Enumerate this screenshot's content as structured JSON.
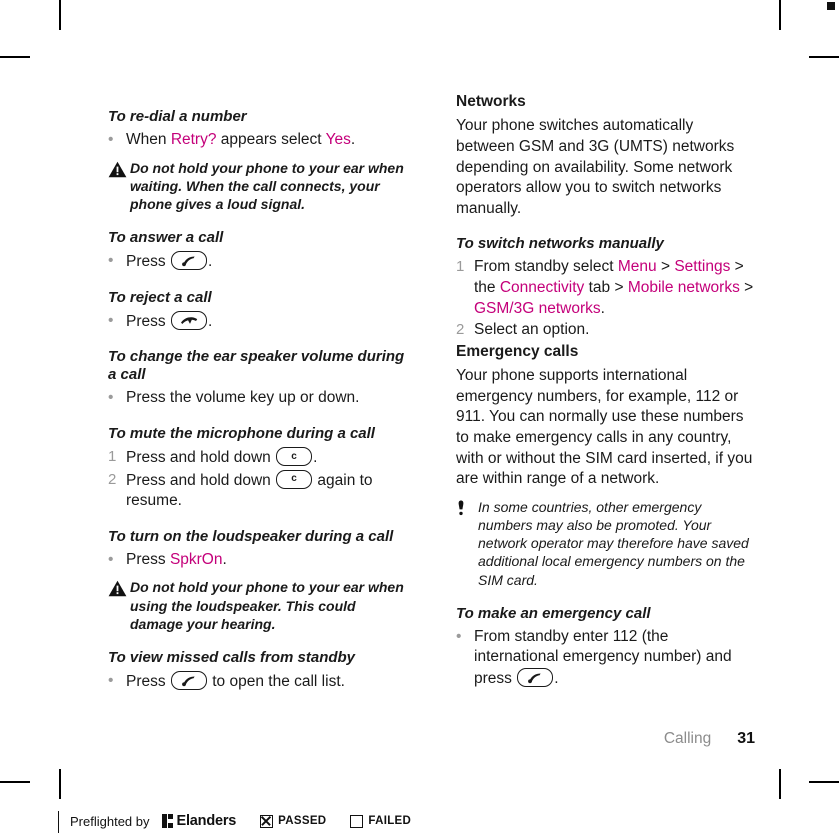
{
  "document": {
    "chapter": "Calling",
    "page_number": "31"
  },
  "accent_color": "#c4007a",
  "left_column": [
    {
      "type": "task-heading",
      "name": "heading-redial",
      "text": "To re-dial a number"
    },
    {
      "type": "bullet",
      "name": "step-redial",
      "parts": [
        {
          "t": "When ",
          "style": "plain"
        },
        {
          "t": "Retry?",
          "style": "ui"
        },
        {
          "t": " appears select ",
          "style": "plain"
        },
        {
          "t": "Yes",
          "style": "ui"
        },
        {
          "t": ".",
          "style": "plain"
        }
      ]
    },
    {
      "type": "note-warning",
      "name": "note-redial-warning",
      "icon": "warning-triangle-icon",
      "text": "Do not hold your phone to your ear when waiting. When the call connects, your phone gives a loud signal."
    },
    {
      "type": "task-heading",
      "name": "heading-answer-call",
      "text": "To answer a call"
    },
    {
      "type": "bullet",
      "name": "step-answer-call",
      "parts": [
        {
          "t": "Press ",
          "style": "plain"
        },
        {
          "t": "",
          "style": "key",
          "key": "call-key",
          "glyph": "handset-up"
        },
        {
          "t": ".",
          "style": "plain"
        }
      ]
    },
    {
      "type": "task-heading",
      "name": "heading-reject-call",
      "text": "To reject a call"
    },
    {
      "type": "bullet",
      "name": "step-reject-call",
      "parts": [
        {
          "t": "Press ",
          "style": "plain"
        },
        {
          "t": "",
          "style": "key",
          "key": "end-call-key",
          "glyph": "handset-down"
        },
        {
          "t": ".",
          "style": "plain"
        }
      ]
    },
    {
      "type": "task-heading",
      "name": "heading-ear-speaker-volume",
      "text": "To change the ear speaker volume during a call"
    },
    {
      "type": "bullet",
      "name": "step-ear-speaker-volume",
      "parts": [
        {
          "t": "Press the volume key up or down.",
          "style": "plain"
        }
      ]
    },
    {
      "type": "task-heading",
      "name": "heading-mute-microphone",
      "text": "To mute the microphone during a call"
    },
    {
      "type": "numbered",
      "name": "step-mute-1",
      "number": "1",
      "parts": [
        {
          "t": "Press and hold down ",
          "style": "plain"
        },
        {
          "t": "",
          "style": "key",
          "key": "clear-key",
          "glyph": "c"
        },
        {
          "t": ".",
          "style": "plain"
        }
      ]
    },
    {
      "type": "numbered",
      "name": "step-mute-2",
      "number": "2",
      "parts": [
        {
          "t": "Press and hold down ",
          "style": "plain"
        },
        {
          "t": "",
          "style": "key",
          "key": "clear-key",
          "glyph": "c"
        },
        {
          "t": " again to resume.",
          "style": "plain"
        }
      ]
    },
    {
      "type": "task-heading",
      "name": "heading-loudspeaker",
      "text": "To turn on the loudspeaker during a call"
    },
    {
      "type": "bullet",
      "name": "step-loudspeaker",
      "parts": [
        {
          "t": "Press ",
          "style": "plain"
        },
        {
          "t": "SpkrOn",
          "style": "ui"
        },
        {
          "t": ".",
          "style": "plain"
        }
      ]
    },
    {
      "type": "note-warning",
      "name": "note-loudspeaker-warning",
      "icon": "warning-triangle-icon",
      "text": "Do not hold your phone to your ear when using the loudspeaker. This could damage your hearing."
    },
    {
      "type": "task-heading",
      "name": "heading-missed-calls",
      "text": "To view missed calls from standby"
    },
    {
      "type": "bullet",
      "name": "step-missed-calls",
      "parts": [
        {
          "t": "Press ",
          "style": "plain"
        },
        {
          "t": "",
          "style": "key",
          "key": "call-key",
          "glyph": "handset-up"
        },
        {
          "t": " to open the call list.",
          "style": "plain"
        }
      ]
    }
  ],
  "right_column": [
    {
      "type": "section-heading",
      "name": "heading-networks",
      "text": "Networks"
    },
    {
      "type": "paragraph",
      "name": "paragraph-networks",
      "text": "Your phone switches automatically between GSM and 3G (UMTS) networks depending on availability. Some network operators allow you to switch networks manually."
    },
    {
      "type": "task-heading",
      "name": "heading-switch-networks",
      "text": "To switch networks manually"
    },
    {
      "type": "numbered",
      "name": "step-switch-networks-1",
      "number": "1",
      "parts": [
        {
          "t": "From standby select ",
          "style": "plain"
        },
        {
          "t": "Menu",
          "style": "ui"
        },
        {
          "t": " > ",
          "style": "plain"
        },
        {
          "t": "Settings",
          "style": "ui"
        },
        {
          "t": " > the ",
          "style": "plain"
        },
        {
          "t": "Connectivity",
          "style": "ui"
        },
        {
          "t": " tab > ",
          "style": "plain"
        },
        {
          "t": "Mobile networks",
          "style": "ui"
        },
        {
          "t": " > ",
          "style": "plain"
        },
        {
          "t": "GSM/3G networks",
          "style": "ui"
        },
        {
          "t": ".",
          "style": "plain"
        }
      ]
    },
    {
      "type": "numbered",
      "name": "step-switch-networks-2",
      "number": "2",
      "parts": [
        {
          "t": "Select an option.",
          "style": "plain"
        }
      ]
    },
    {
      "type": "section-heading",
      "name": "heading-emergency-calls",
      "text": "Emergency calls"
    },
    {
      "type": "paragraph",
      "name": "paragraph-emergency-calls",
      "text": "Your phone supports international emergency numbers, for example, 112 or 911. You can normally use these numbers to make emergency calls in any country, with or without the SIM card inserted, if you are within range of a network."
    },
    {
      "type": "note-tip",
      "name": "note-emergency-tip",
      "icon": "tip-exclamation-icon",
      "text": "In some countries, other emergency numbers may also be promoted. Your network operator may therefore have saved additional local emergency numbers on the SIM card."
    },
    {
      "type": "task-heading",
      "name": "heading-make-emergency-call",
      "text": "To make an emergency call"
    },
    {
      "type": "bullet",
      "name": "step-make-emergency-call",
      "parts": [
        {
          "t": "From standby enter 112 (the international emergency number) and press ",
          "style": "plain"
        },
        {
          "t": "",
          "style": "key",
          "key": "call-key",
          "glyph": "handset-up"
        },
        {
          "t": ".",
          "style": "plain"
        }
      ]
    }
  ],
  "preflight": {
    "label": "Preflighted by",
    "brand": "Elanders",
    "passed_label": "PASSED",
    "failed_label": "FAILED",
    "passed_checked": true,
    "failed_checked": false
  }
}
